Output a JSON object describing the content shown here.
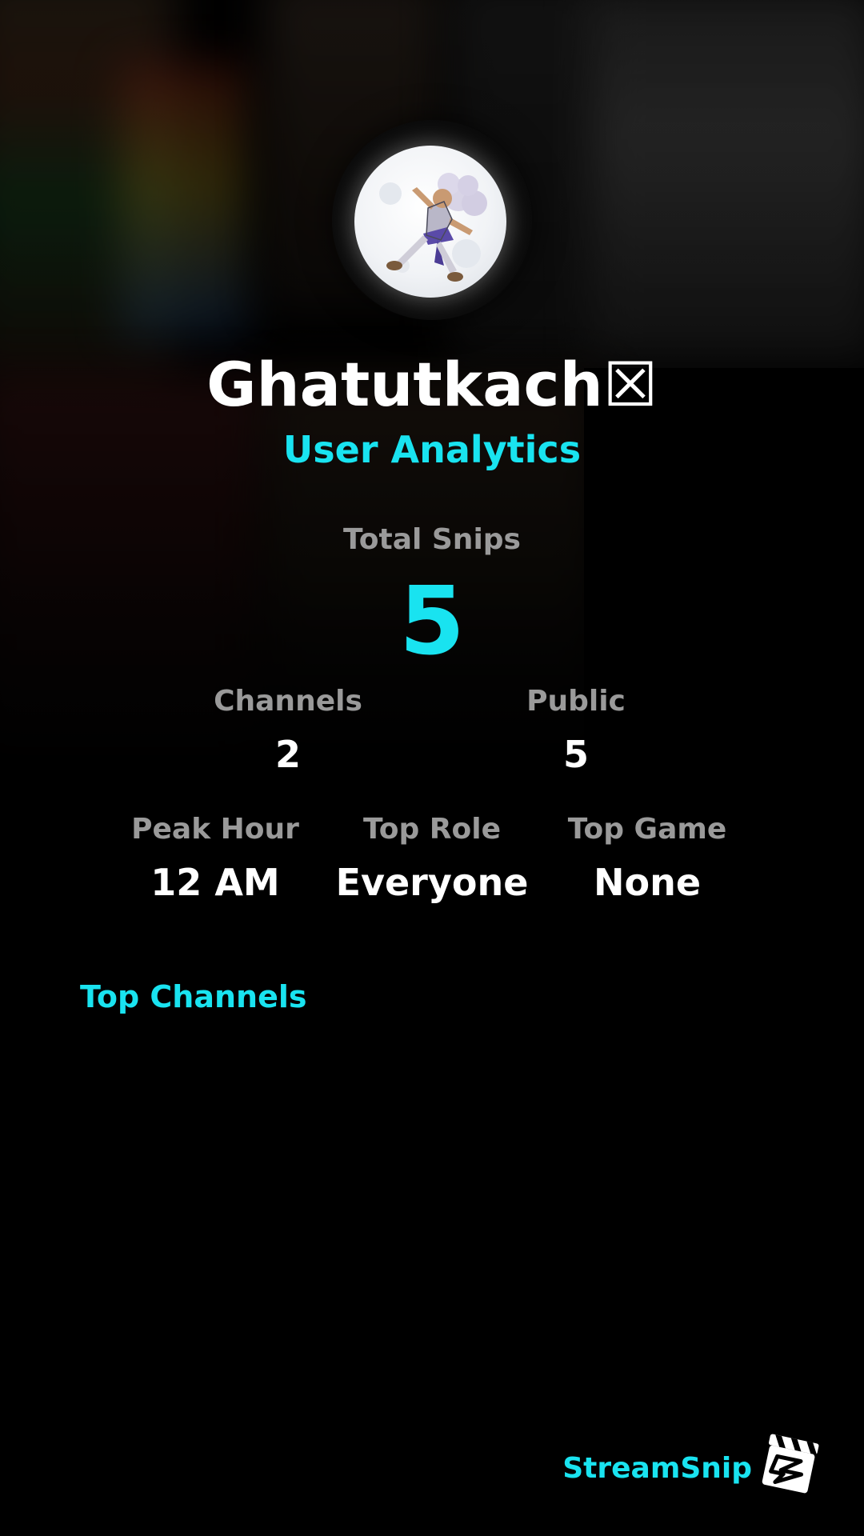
{
  "profile": {
    "display_name": "Ghatutkach☒",
    "subtitle": "User Analytics",
    "avatar_alt": "avatar"
  },
  "summary": {
    "total_label": "Total Snips",
    "total_value": "5"
  },
  "stats_row1": [
    {
      "label": "Channels",
      "value": "2"
    },
    {
      "label": "Public",
      "value": "5"
    }
  ],
  "stats_row2": [
    {
      "label": "Peak Hour",
      "value": "12 AM"
    },
    {
      "label": "Top Role",
      "value": "Everyone"
    },
    {
      "label": "Top Game",
      "value": "None"
    }
  ],
  "sections": {
    "top_channels_label": "Top Channels"
  },
  "branding": {
    "name": "StreamSnip",
    "logo_icon": "clapperboard-icon"
  },
  "colors": {
    "accent": "#19e3f0",
    "label_gray": "#9a9a9a",
    "background": "#000000",
    "text": "#ffffff"
  }
}
